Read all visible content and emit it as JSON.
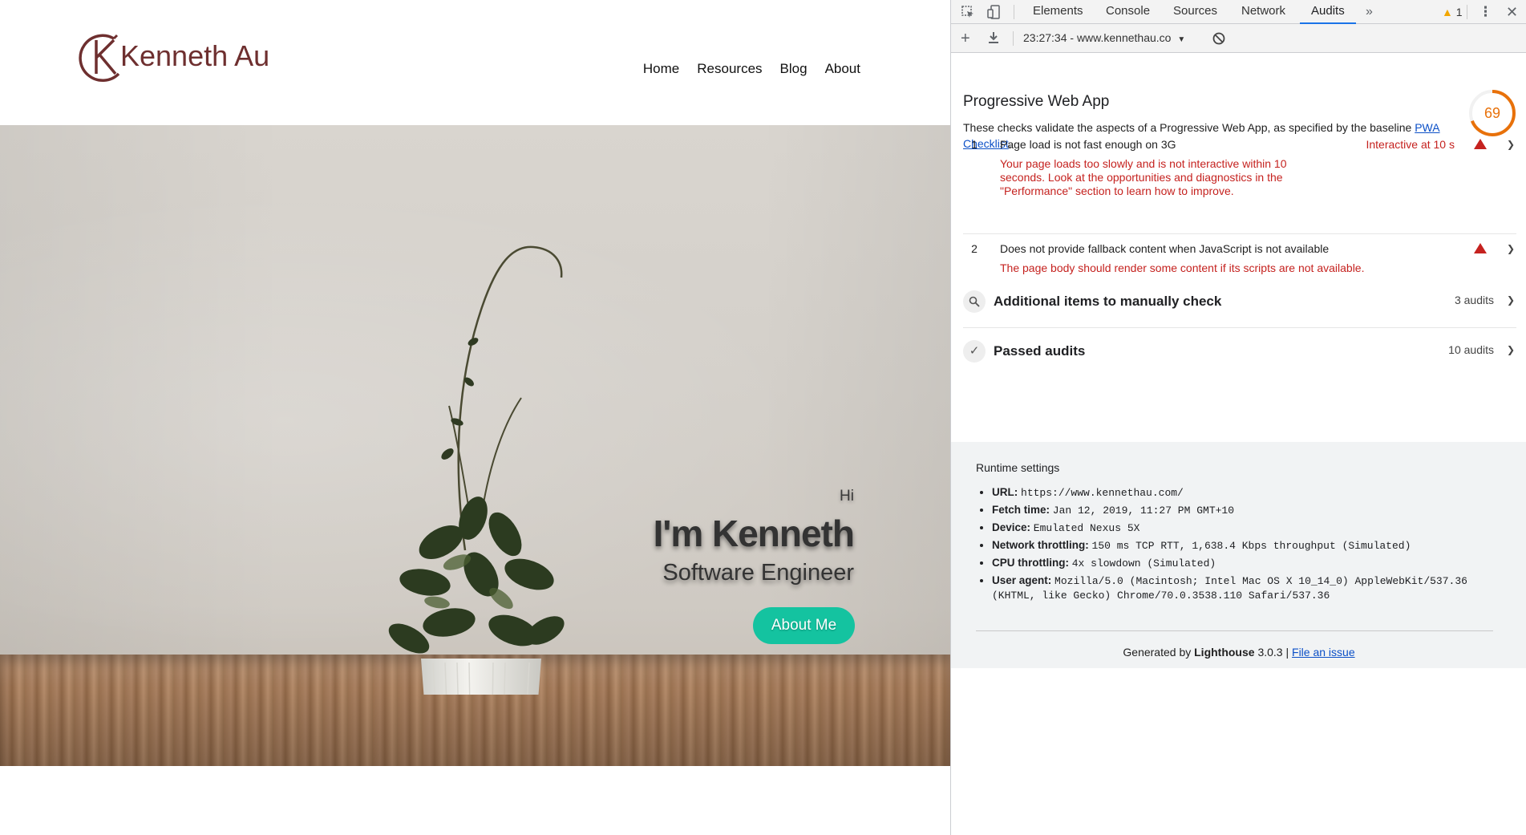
{
  "site": {
    "logo_text": "Kenneth Au",
    "nav": [
      "Home",
      "Resources",
      "Blog",
      "About"
    ],
    "hero": {
      "greeting": "Hi",
      "name": "I'm Kenneth",
      "role": "Software Engineer",
      "button": "About Me"
    },
    "colors": {
      "logo": "#6e2f2f",
      "button": "#14c3a0"
    }
  },
  "devtools": {
    "tabs": [
      "Elements",
      "Console",
      "Sources",
      "Network",
      "Audits"
    ],
    "active_tab": "Audits",
    "warning_count": "1",
    "report_select": "23:27:34 - www.kennethau.co",
    "icons": [
      "inspect-icon",
      "device-icon",
      "more-tabs-icon",
      "warning-icon",
      "kebab-icon",
      "close-icon",
      "add-icon",
      "download-icon",
      "clear-icon"
    ]
  },
  "report": {
    "category_title": "Progressive Web App",
    "category_desc": "These checks validate the aspects of a Progressive Web App, as specified by the baseline",
    "checklist_link": "PWA Checklist",
    "score": 69,
    "score_color": "#e8710a",
    "audits": [
      {
        "num": "1",
        "title": "Page load is not fast enough on 3G",
        "value": "Interactive at 10 s",
        "desc": "Your page loads too slowly and is not interactive within 10 seconds. Look at the opportunities and diagnostics in the \"Performance\" section to learn how to improve."
      },
      {
        "num": "2",
        "title": "Does not provide fallback content when JavaScript is not available",
        "value": "",
        "desc": "The page body should render some content if its scripts are not available."
      }
    ],
    "groups": [
      {
        "title": "Additional items to manually check",
        "count": "3 audits"
      },
      {
        "title": "Passed audits",
        "count": "10 audits"
      }
    ],
    "runtime": {
      "title": "Runtime settings",
      "items": [
        {
          "k": "URL:",
          "v": "https://www.kennethau.com/"
        },
        {
          "k": "Fetch time:",
          "v": "Jan 12, 2019, 11:27 PM GMT+10"
        },
        {
          "k": "Device:",
          "v": "Emulated Nexus 5X"
        },
        {
          "k": "Network throttling:",
          "v": "150 ms TCP RTT, 1,638.4 Kbps throughput (Simulated)"
        },
        {
          "k": "CPU throttling:",
          "v": "4x slowdown (Simulated)"
        },
        {
          "k": "User agent:",
          "v": "Mozilla/5.0 (Macintosh; Intel Mac OS X 10_14_0) AppleWebKit/537.36 (KHTML, like Gecko) Chrome/70.0.3538.110 Safari/537.36"
        }
      ]
    },
    "footer": {
      "prefix": "Generated by",
      "brand": "Lighthouse",
      "version": "3.0.3 |",
      "link": "File an issue"
    }
  }
}
